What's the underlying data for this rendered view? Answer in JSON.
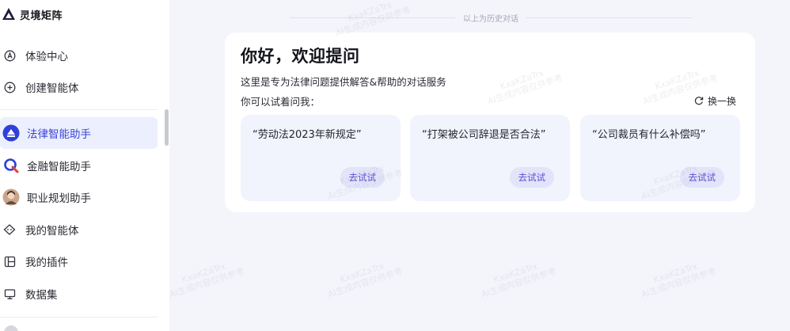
{
  "brand": {
    "name": "灵境矩阵",
    "logo_icon": "mountain-logo-icon"
  },
  "sidebar": {
    "items": [
      {
        "label": "体验中心",
        "icon": "experience-center-icon"
      },
      {
        "label": "创建智能体",
        "icon": "plus-circle-icon"
      }
    ],
    "agents": [
      {
        "label": "法律智能助手",
        "icon": "law-assistant-avatar",
        "active": true
      },
      {
        "label": "金融智能助手",
        "icon": "finance-assistant-avatar"
      },
      {
        "label": "职业规划助手",
        "icon": "career-assistant-avatar"
      }
    ],
    "links": [
      {
        "label": "我的智能体",
        "icon": "my-agents-icon"
      },
      {
        "label": "我的插件",
        "icon": "plugin-icon"
      },
      {
        "label": "数据集",
        "icon": "dataset-icon"
      }
    ]
  },
  "main": {
    "history_separator": "以上为历史对话",
    "welcome": {
      "title": "你好，欢迎提问",
      "description": "这里是专为法律问题提供解答&帮助的对话服务",
      "hint": "你可以试着问我：",
      "refresh_label": "换一换",
      "suggestions": [
        {
          "question": "“劳动法2023年新规定”",
          "action": "去试试"
        },
        {
          "question": "“打架被公司辞退是否合法”",
          "action": "去试试"
        },
        {
          "question": "“公司裁员有什么补偿吗”",
          "action": "去试试"
        }
      ]
    },
    "watermark": {
      "line1": "KxaKZaTrx",
      "line2": "AI生成内容仅供参考"
    }
  },
  "colors": {
    "accent": "#3b46d8",
    "active_bg": "#eceffd",
    "page_bg": "#f4f5fb",
    "try_bg": "#e3e3fa",
    "try_text": "#5a4fd6"
  }
}
